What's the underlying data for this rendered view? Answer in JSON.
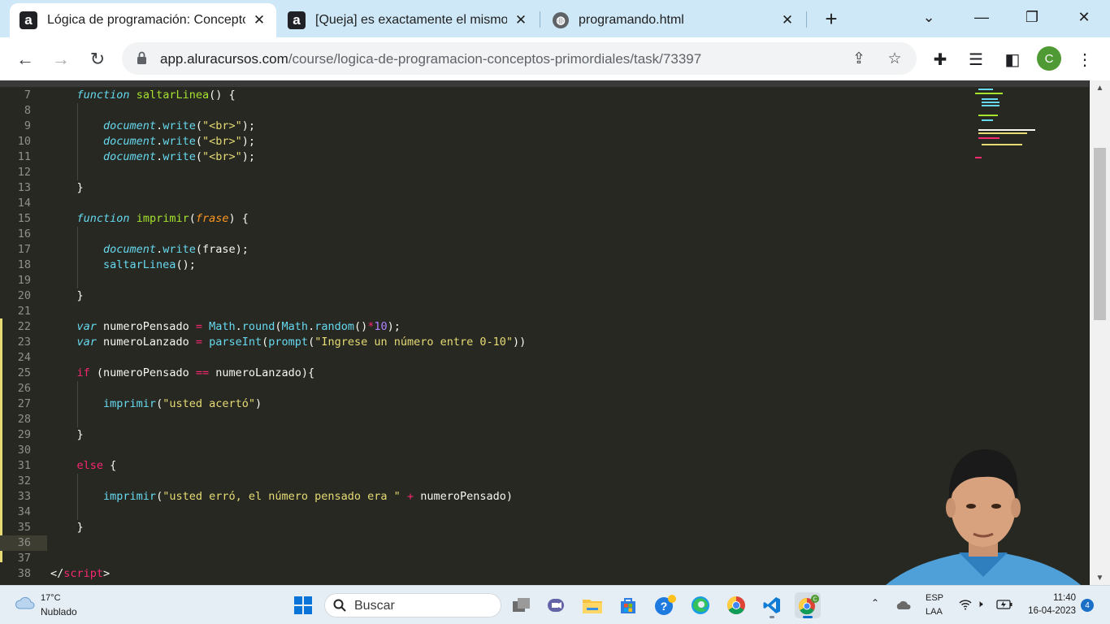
{
  "browser": {
    "tabs": [
      {
        "title": "Lógica de programación: Conceptos primordiales",
        "favicon": "alura-logo-icon",
        "active": true
      },
      {
        "title": "[Queja] es exactamente el mismo",
        "favicon": "alura-logo-icon",
        "active": false
      },
      {
        "title": "programando.html",
        "favicon": "globe-icon",
        "active": false
      }
    ],
    "new_tab_label": "+",
    "url_host": "app.aluracursos.com",
    "url_path": "/course/logica-de-programacion-conceptos-primordiales/task/73397",
    "profile_initial": "C"
  },
  "editor": {
    "lines": [
      {
        "n": "7",
        "html": "    <span class='tok-kw'>function</span> <span class='tok-fn'>saltarLinea</span>() {"
      },
      {
        "n": "8",
        "html": ""
      },
      {
        "n": "9",
        "html": "        <span class='tok-fni'>document</span>.<span class='tok-obj'>write</span>(<span class='tok-str'>\"&lt;br&gt;\"</span>);"
      },
      {
        "n": "10",
        "html": "        <span class='tok-fni'>document</span>.<span class='tok-obj'>write</span>(<span class='tok-str'>\"&lt;br&gt;\"</span>);"
      },
      {
        "n": "11",
        "html": "        <span class='tok-fni'>document</span>.<span class='tok-obj'>write</span>(<span class='tok-str'>\"&lt;br&gt;\"</span>);"
      },
      {
        "n": "12",
        "html": ""
      },
      {
        "n": "13",
        "html": "    }"
      },
      {
        "n": "14",
        "html": ""
      },
      {
        "n": "15",
        "html": "    <span class='tok-kw'>function</span> <span class='tok-fn'>imprimir</span>(<span class='tok-param'>frase</span>) {"
      },
      {
        "n": "16",
        "html": ""
      },
      {
        "n": "17",
        "html": "        <span class='tok-fni'>document</span>.<span class='tok-obj'>write</span>(frase);"
      },
      {
        "n": "18",
        "html": "        <span class='tok-obj'>saltarLinea</span>();"
      },
      {
        "n": "19",
        "html": ""
      },
      {
        "n": "20",
        "html": "    }"
      },
      {
        "n": "21",
        "html": ""
      },
      {
        "n": "22",
        "html": "    <span class='tok-kw'>var</span> numeroPensado <span class='tok-op'>=</span> <span class='tok-obj'>Math</span>.<span class='tok-obj'>round</span>(<span class='tok-obj'>Math</span>.<span class='tok-obj'>random</span>()<span class='tok-op'>*</span><span class='tok-num'>10</span>);"
      },
      {
        "n": "23",
        "html": "    <span class='tok-kw'>var</span> numeroLanzado <span class='tok-op'>=</span> <span class='tok-obj'>parseInt</span>(<span class='tok-obj'>prompt</span>(<span class='tok-str'>\"Ingrese un número entre 0-10\"</span>))"
      },
      {
        "n": "24",
        "html": ""
      },
      {
        "n": "25",
        "html": "    <span class='tok-ctl'>if</span> (numeroPensado <span class='tok-op'>==</span> numeroLanzado){"
      },
      {
        "n": "26",
        "html": ""
      },
      {
        "n": "27",
        "html": "        <span class='tok-obj'>imprimir</span>(<span class='tok-str'>\"usted acertó\"</span>)"
      },
      {
        "n": "28",
        "html": ""
      },
      {
        "n": "29",
        "html": "    }"
      },
      {
        "n": "30",
        "html": ""
      },
      {
        "n": "31",
        "html": "    <span class='tok-ctl'>else</span> {"
      },
      {
        "n": "32",
        "html": ""
      },
      {
        "n": "33",
        "html": "        <span class='tok-obj'>imprimir</span>(<span class='tok-str'>\"usted erró, el número pensado era \"</span> <span class='tok-op'>+</span> numeroPensado)"
      },
      {
        "n": "34",
        "html": ""
      },
      {
        "n": "35",
        "html": "    }"
      },
      {
        "n": "36",
        "html": ""
      },
      {
        "n": "37",
        "html": ""
      },
      {
        "n": "38",
        "html": "&lt;/<span class='tok-tag'>script</span>&gt;"
      }
    ],
    "current_line": "36"
  },
  "taskbar": {
    "weather_temp": "17°C",
    "weather_condition": "Nublado",
    "search_placeholder": "Buscar",
    "lang_primary": "ESP",
    "lang_secondary": "LAA",
    "time": "11:40",
    "date": "16-04-2023",
    "notification_count": "4"
  },
  "colors": {
    "editor_bg": "#272822",
    "tabstrip_bg": "#cfe8f7",
    "taskbar_bg": "#e6eef5"
  }
}
